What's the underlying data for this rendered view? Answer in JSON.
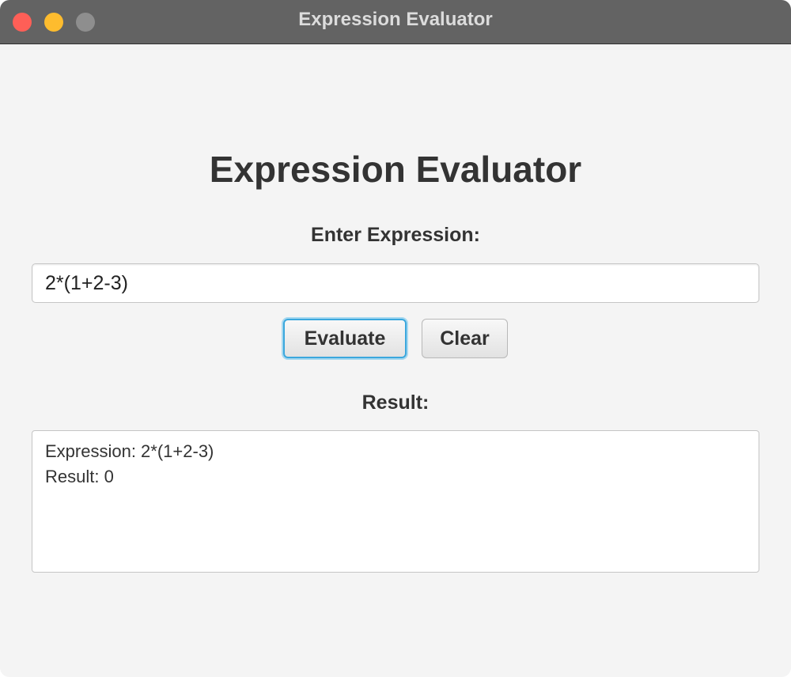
{
  "window": {
    "title": "Expression Evaluator"
  },
  "main": {
    "heading": "Expression Evaluator",
    "input_label": "Enter Expression:",
    "expression_value": "2*(1+2-3)",
    "evaluate_label": "Evaluate",
    "clear_label": "Clear",
    "result_label": "Result:",
    "result_lines": [
      "Expression: 2*(1+2-3)",
      "Result: 0"
    ]
  },
  "colors": {
    "titlebar": "#636363",
    "background": "#f4f4f4",
    "close": "#fe5f57",
    "minimize": "#febc2e",
    "zoom": "#8e8e8e",
    "focus_ring": "#3aa7dd"
  }
}
